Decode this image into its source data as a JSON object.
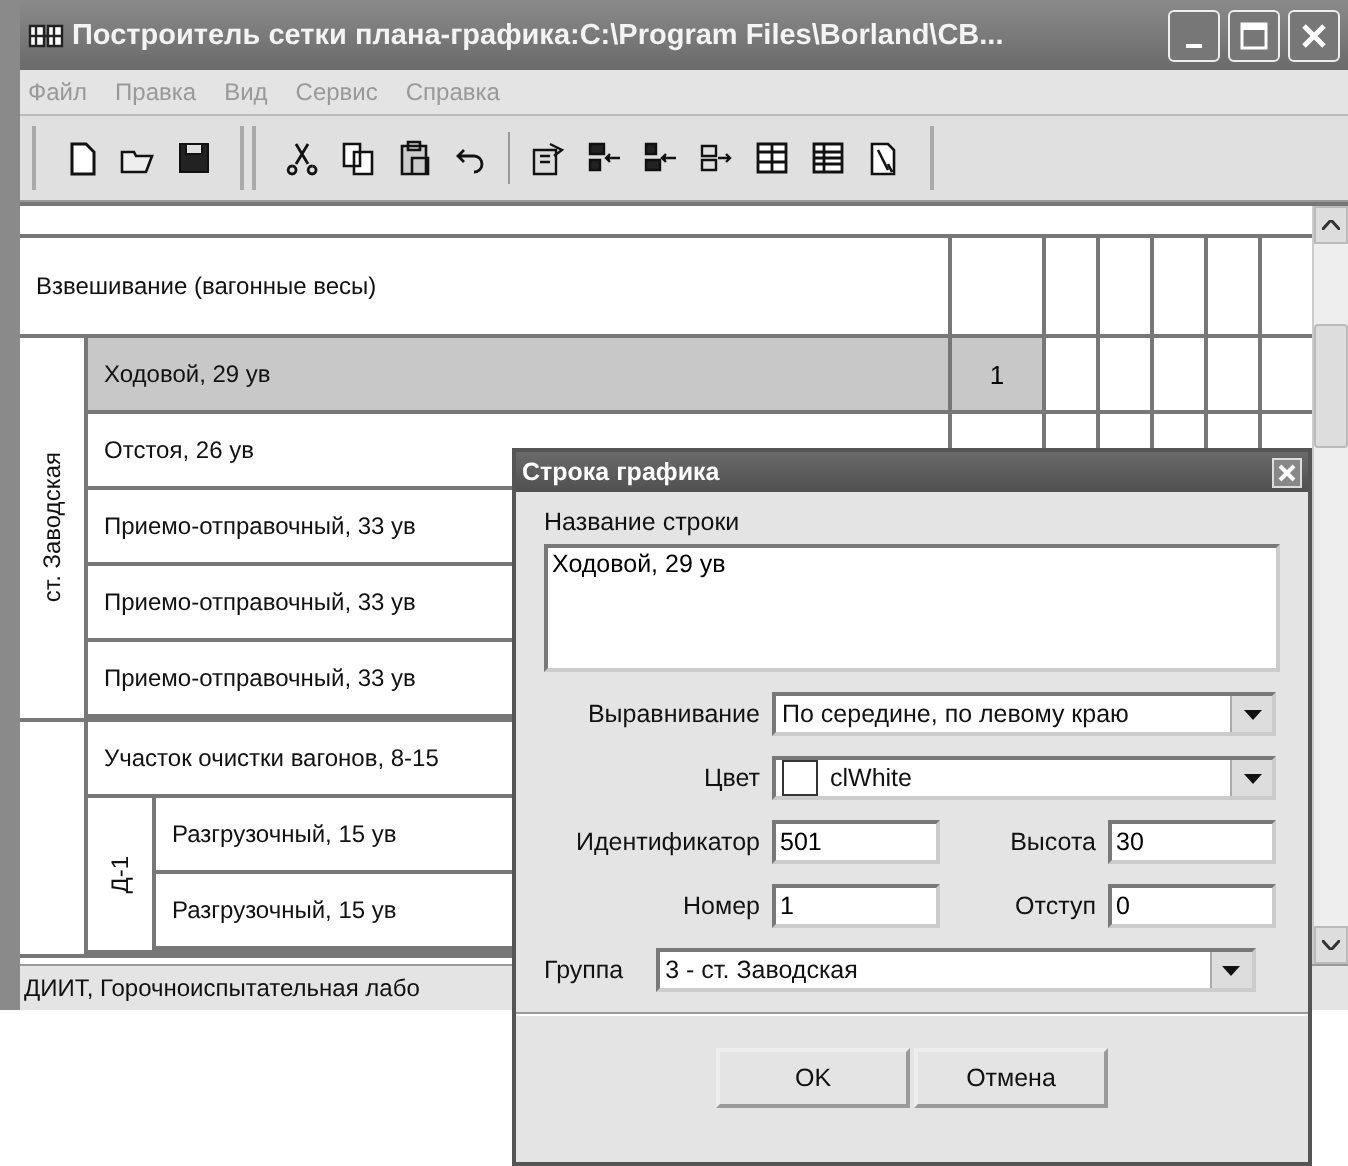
{
  "window": {
    "title": "Построитель сетки плана-графика:C:\\Program Files\\Borland\\CB..."
  },
  "menu": [
    "Файл",
    "Правка",
    "Вид",
    "Сервис",
    "Справка"
  ],
  "grid": {
    "rows": [
      {
        "kind": "row",
        "label": "Взвешивание (вагонные весы)",
        "selected": false
      },
      {
        "kind": "group",
        "label": "ст. Заводская",
        "children": [
          {
            "kind": "row",
            "label": "Ходовой, 29 ув",
            "number": "1",
            "selected": true
          },
          {
            "kind": "row",
            "label": "Отстоя, 26 ув",
            "selected": false
          },
          {
            "kind": "row",
            "label": "Приемо-отправочный, 33 ув",
            "selected": false
          },
          {
            "kind": "row",
            "label": "Приемо-отправочный, 33 ув",
            "selected": false
          },
          {
            "kind": "row",
            "label": "Приемо-отправочный, 33 ув",
            "selected": false
          }
        ]
      },
      {
        "kind": "group",
        "children": [
          {
            "kind": "row",
            "label": "Участок очистки вагонов, 8-15",
            "selected": false
          },
          {
            "kind": "group",
            "label": "Д-1",
            "children": [
              {
                "kind": "row",
                "label": "Разгрузочный, 15 ув",
                "selected": false
              },
              {
                "kind": "row",
                "label": "Разгрузочный, 15 ув",
                "selected": false
              }
            ]
          }
        ]
      }
    ]
  },
  "status": "ДИИТ, Горочноиспытательная лабо",
  "dialog": {
    "title": "Строка графика",
    "row_name": {
      "label": "Название строки",
      "value": "Ходовой, 29 ув"
    },
    "alignment": {
      "label": "Выравнивание",
      "value": "По середине, по левому краю"
    },
    "color": {
      "label": "Цвет",
      "value": "clWhite"
    },
    "identifier": {
      "label": "Идентификатор",
      "value": "501"
    },
    "height": {
      "label": "Высота",
      "value": "30"
    },
    "number": {
      "label": "Номер",
      "value": "1"
    },
    "indent": {
      "label": "Отступ",
      "value": "0"
    },
    "group": {
      "label": "Группа",
      "value": "3 - ст. Заводская"
    },
    "buttons": [
      "OK",
      "Отмена"
    ]
  }
}
